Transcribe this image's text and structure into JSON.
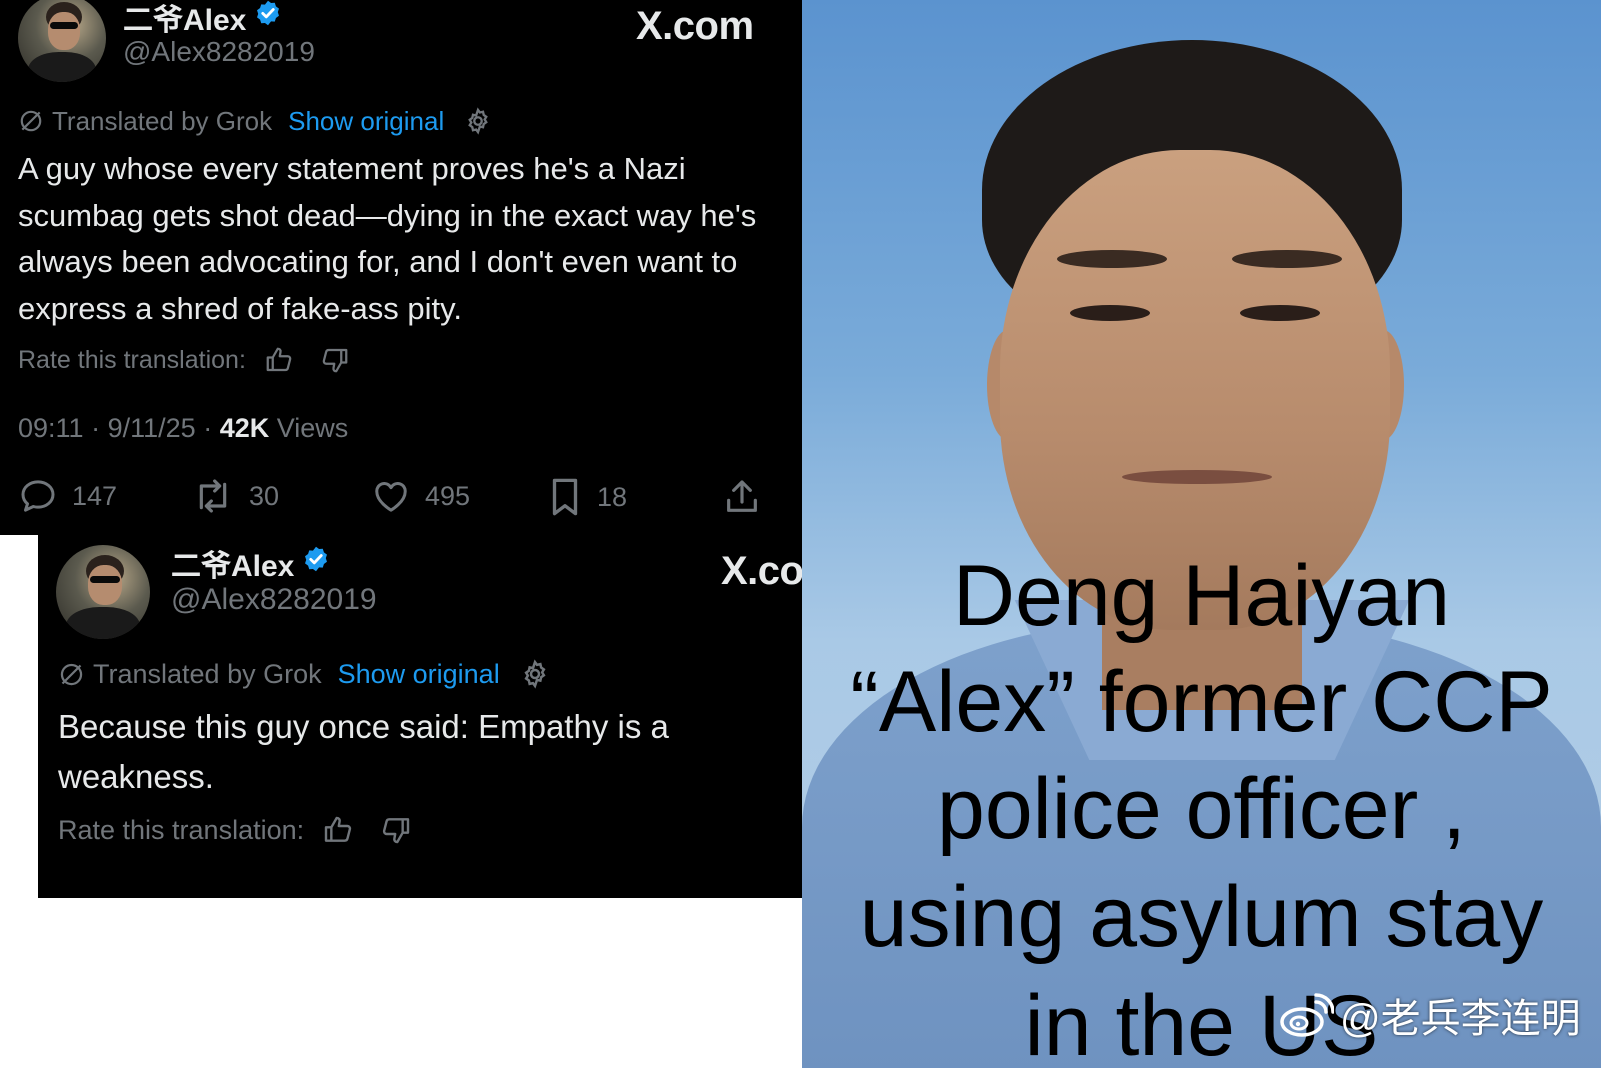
{
  "tweet1": {
    "display_name": "二爷Alex",
    "handle": "@Alex8282019",
    "site_logo": "X.com",
    "translated_by": "Translated by Grok",
    "show_original": "Show original",
    "text": "A guy whose every statement proves he's a Nazi scumbag gets shot dead—dying in the exact way he's always been advocating for, and I don't even want to express a shred of fake-ass pity.",
    "rate_label": "Rate this translation:",
    "time": "09:11",
    "date": "9/11/25",
    "views_count": "42K",
    "views_label": "Views",
    "replies": "147",
    "reposts": "30",
    "likes": "495",
    "bookmarks": "18"
  },
  "tweet2": {
    "display_name": "二爷Alex",
    "handle": "@Alex8282019",
    "site_logo": "X.co",
    "translated_by": "Translated by Grok",
    "show_original": "Show original",
    "text": "Because this guy once said: Empathy is a weakness.",
    "rate_label": "Rate this translation:"
  },
  "overlay": {
    "lines": [
      "Deng Haiyan",
      "“Alex” former CCP",
      "police officer ,",
      "using asylum stay",
      "in the US"
    ]
  },
  "watermark": {
    "text": "@老兵李连明"
  },
  "colors": {
    "tweet_bg": "#000000",
    "primary_text": "#e7e9ea",
    "secondary_text": "#71767b",
    "link_blue": "#1d9bf0",
    "verified_blue": "#1d9bf0"
  },
  "icons": [
    "grok-icon",
    "gear-icon",
    "thumbs-up-icon",
    "thumbs-down-icon",
    "reply-icon",
    "repost-icon",
    "like-icon",
    "bookmark-icon",
    "share-icon",
    "verified-badge-icon",
    "weibo-icon"
  ]
}
